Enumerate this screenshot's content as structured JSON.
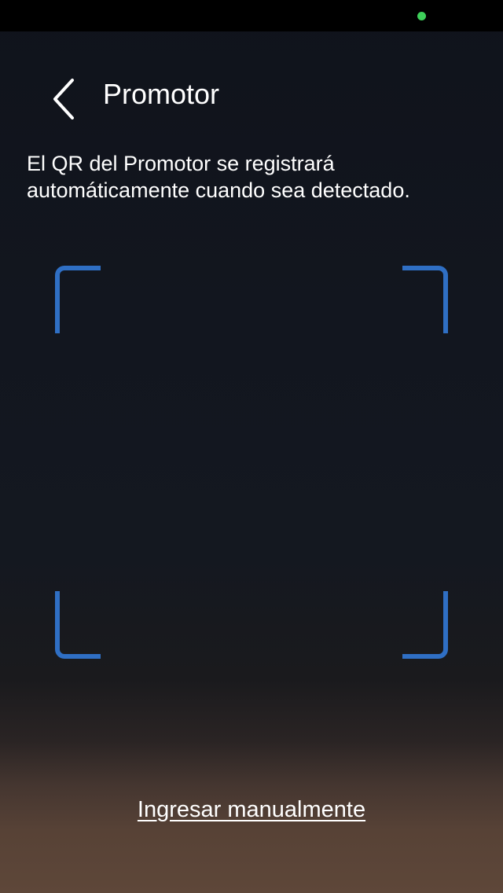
{
  "status_bar": {
    "indicator_color": "#3ecf5a"
  },
  "header": {
    "back_icon": "chevron-left-icon",
    "title": "Promotor"
  },
  "instructions": {
    "text": "El QR del Promotor se registrará automáticamente cuando sea detectado."
  },
  "scanner": {
    "frame_icon": "qr-scan-frame",
    "frame_color": "#2f6fc4"
  },
  "footer": {
    "manual_entry_label": "Ingresar manualmente"
  }
}
